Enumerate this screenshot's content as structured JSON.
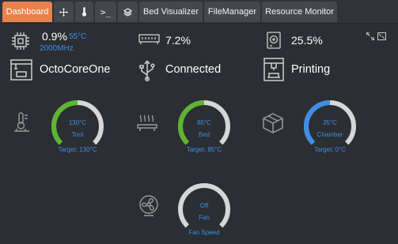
{
  "tabs": [
    {
      "label": "Dashboard",
      "active": true
    },
    {
      "icon": "move-arrows-icon"
    },
    {
      "icon": "thermometer-icon"
    },
    {
      "label": ">_",
      "icon": "terminal-icon"
    },
    {
      "icon": "gcode-viewer-icon"
    },
    {
      "label": "Bed Visualizer"
    },
    {
      "label": "FileManager"
    },
    {
      "label": "Resource Monitor"
    }
  ],
  "stats": {
    "cpu": {
      "load": "0.9%",
      "temp": "55°C",
      "freq": "2000MHz"
    },
    "memory": {
      "value": "7.2%"
    },
    "disk": {
      "value": "25.5%"
    },
    "host": {
      "name": "OctoCoreOne"
    },
    "connection": {
      "status": "Connected"
    },
    "printer": {
      "state": "Printing"
    }
  },
  "gauges": {
    "tool": {
      "value_text": "130°C",
      "name": "Tool",
      "target": "Target: 130°C",
      "fraction": 0.5,
      "color": "#5cb531"
    },
    "bed": {
      "value_text": "85°C",
      "name": "Bed",
      "target": "Target: 85°C",
      "fraction": 0.5,
      "color": "#5cb531"
    },
    "chamber": {
      "value_text": "35°C",
      "name": "Chamber",
      "target": "Target: 0°C",
      "fraction": 0.5,
      "color": "#3d8ee4"
    },
    "fan": {
      "value_text": "Off",
      "name": "Fan",
      "label": "Fan Speed",
      "fraction": 0.0,
      "color": "#3d8ee4"
    }
  },
  "colors": {
    "accent": "#e9814d",
    "blue": "#3d8ee4",
    "green": "#5cb531",
    "track": "#d6d6d6"
  }
}
